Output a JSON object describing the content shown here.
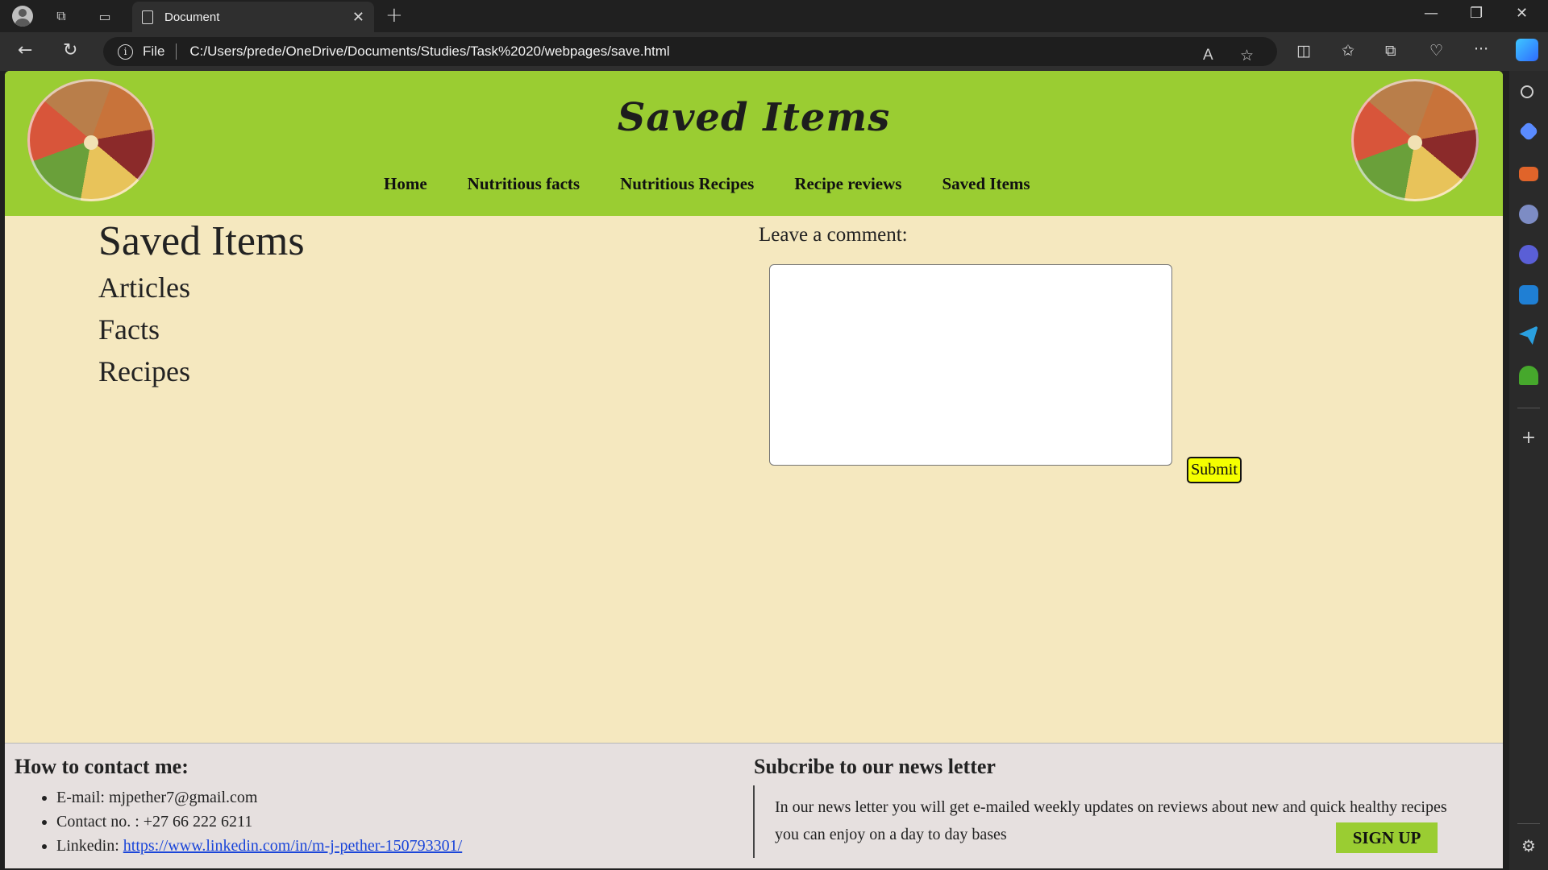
{
  "browser": {
    "tab_title": "Document",
    "address_prefix": "File",
    "url": "C:/Users/prede/OneDrive/Documents/Studies/Task%2020/webpages/save.html"
  },
  "site": {
    "title": "Saved Items",
    "nav": [
      "Home",
      "Nutritious facts",
      "Nutritious Recipes",
      "Recipe reviews",
      "Saved Items"
    ]
  },
  "main": {
    "heading": "Saved Items",
    "items": [
      "Articles",
      "Facts",
      "Recipes"
    ],
    "comment_label": "Leave a comment:",
    "submit_label": "Submit"
  },
  "footer": {
    "contact_title": "How to contact me:",
    "email": "E-mail: mjpether7@gmail.com",
    "phone": "Contact no. : +27 66 222 6211",
    "linkedin_label": "Linkedin: ",
    "linkedin_url": "https://www.linkedin.com/in/m-j-pether-150793301/",
    "newsletter_title": "Subcribe to our news letter",
    "newsletter_text": "In our news letter you will get e-mailed weekly updates on reviews about new and quick healthy recipes you can enjoy on a day to day bases",
    "signup_label": "SIGN UP"
  },
  "colors": {
    "header_green": "#9acd32",
    "page_bg": "#f5e8bf",
    "footer_bg": "#e6e0df",
    "submit_yellow": "#f5ff00"
  }
}
